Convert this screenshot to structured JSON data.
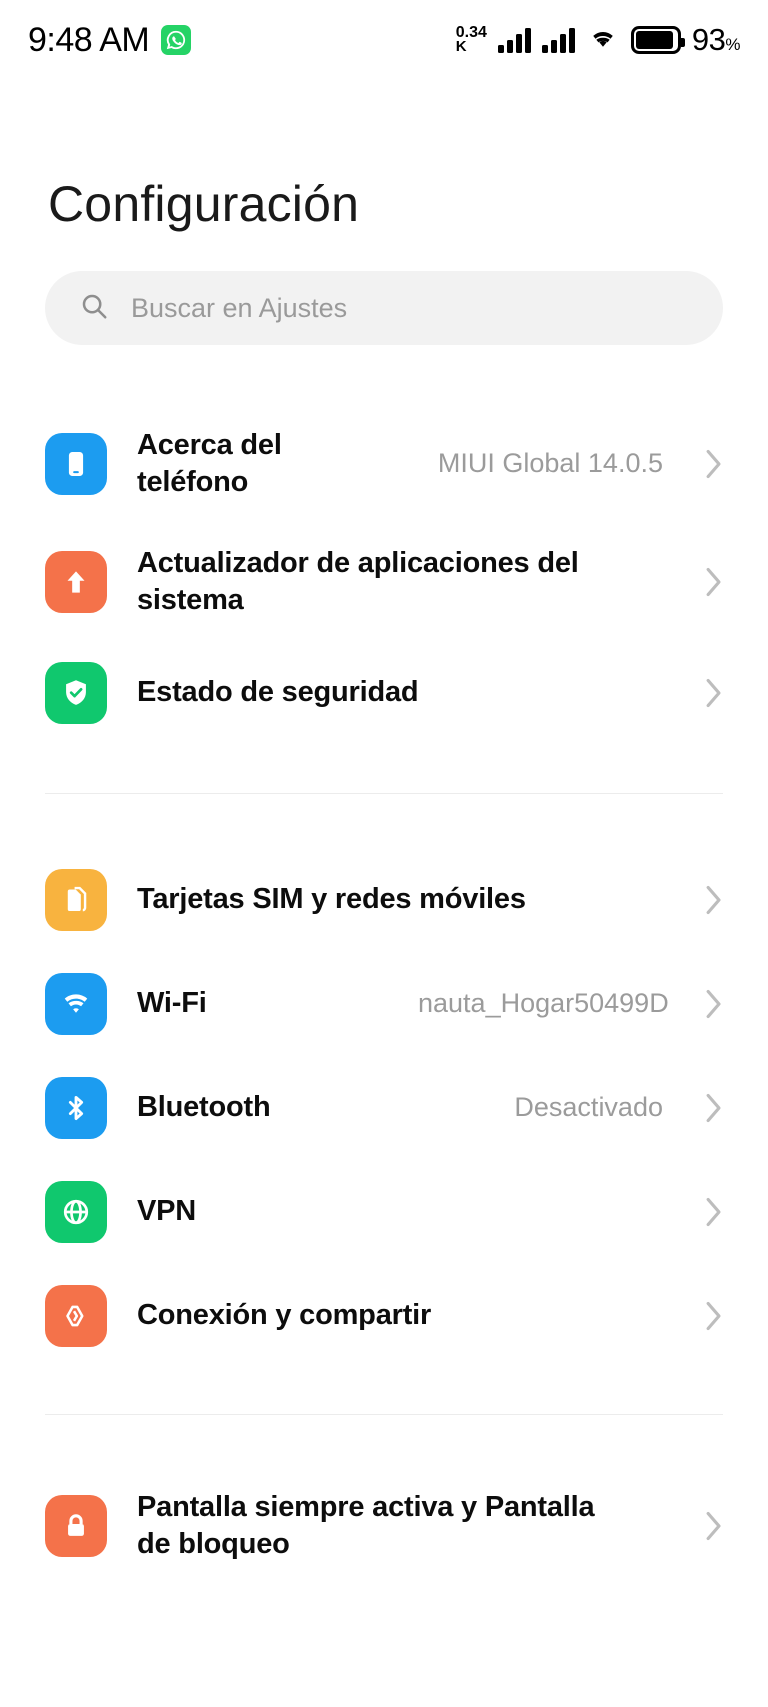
{
  "statusbar": {
    "time": "9:48 AM",
    "app_icon": "whatsapp-icon",
    "data_rate_value": "0.34",
    "data_rate_unit": "K",
    "signal_icon_1": "signal-bars-icon",
    "signal_icon_2": "signal-bars-icon",
    "wifi_icon": "wifi-icon",
    "battery_icon": "battery-icon",
    "battery_percent": "93",
    "battery_percent_symbol": "%"
  },
  "header": {
    "title": "Configuración"
  },
  "search": {
    "placeholder": "Buscar en Ajustes",
    "icon": "search-icon"
  },
  "groups": [
    {
      "items": [
        {
          "label": "Acerca del teléfono",
          "value": "MIUI Global 14.0.5",
          "icon": "phone-icon",
          "icon_color": "#1C9CF0",
          "chevron": "chevron-right-icon"
        },
        {
          "label": "Actualizador de aplicaciones del sistema",
          "value": "",
          "icon": "arrow-up-icon",
          "icon_color": "#F4724A",
          "chevron": "chevron-right-icon"
        },
        {
          "label": "Estado de seguridad",
          "value": "",
          "icon": "shield-check-icon",
          "icon_color": "#10C86E",
          "chevron": "chevron-right-icon"
        }
      ]
    },
    {
      "items": [
        {
          "label": "Tarjetas SIM y redes móviles",
          "value": "",
          "icon": "sim-card-icon",
          "icon_color": "#F8B33F",
          "chevron": "chevron-right-icon"
        },
        {
          "label": "Wi-Fi",
          "value": "nauta_Hogar50499D",
          "icon": "wifi-icon",
          "icon_color": "#1C9CF0",
          "chevron": "chevron-right-icon"
        },
        {
          "label": "Bluetooth",
          "value": "Desactivado",
          "icon": "bluetooth-icon",
          "icon_color": "#1C9CF0",
          "chevron": "chevron-right-icon"
        },
        {
          "label": "VPN",
          "value": "",
          "icon": "globe-icon",
          "icon_color": "#10C86E",
          "chevron": "chevron-right-icon"
        },
        {
          "label": "Conexión y compartir",
          "value": "",
          "icon": "share-connection-icon",
          "icon_color": "#F4724A",
          "chevron": "chevron-right-icon"
        }
      ]
    },
    {
      "items": [
        {
          "label": "Pantalla siempre activa y Pantalla de bloqueo",
          "value": "",
          "icon": "lock-icon",
          "icon_color": "#F4724A",
          "chevron": "chevron-right-icon"
        }
      ]
    }
  ]
}
